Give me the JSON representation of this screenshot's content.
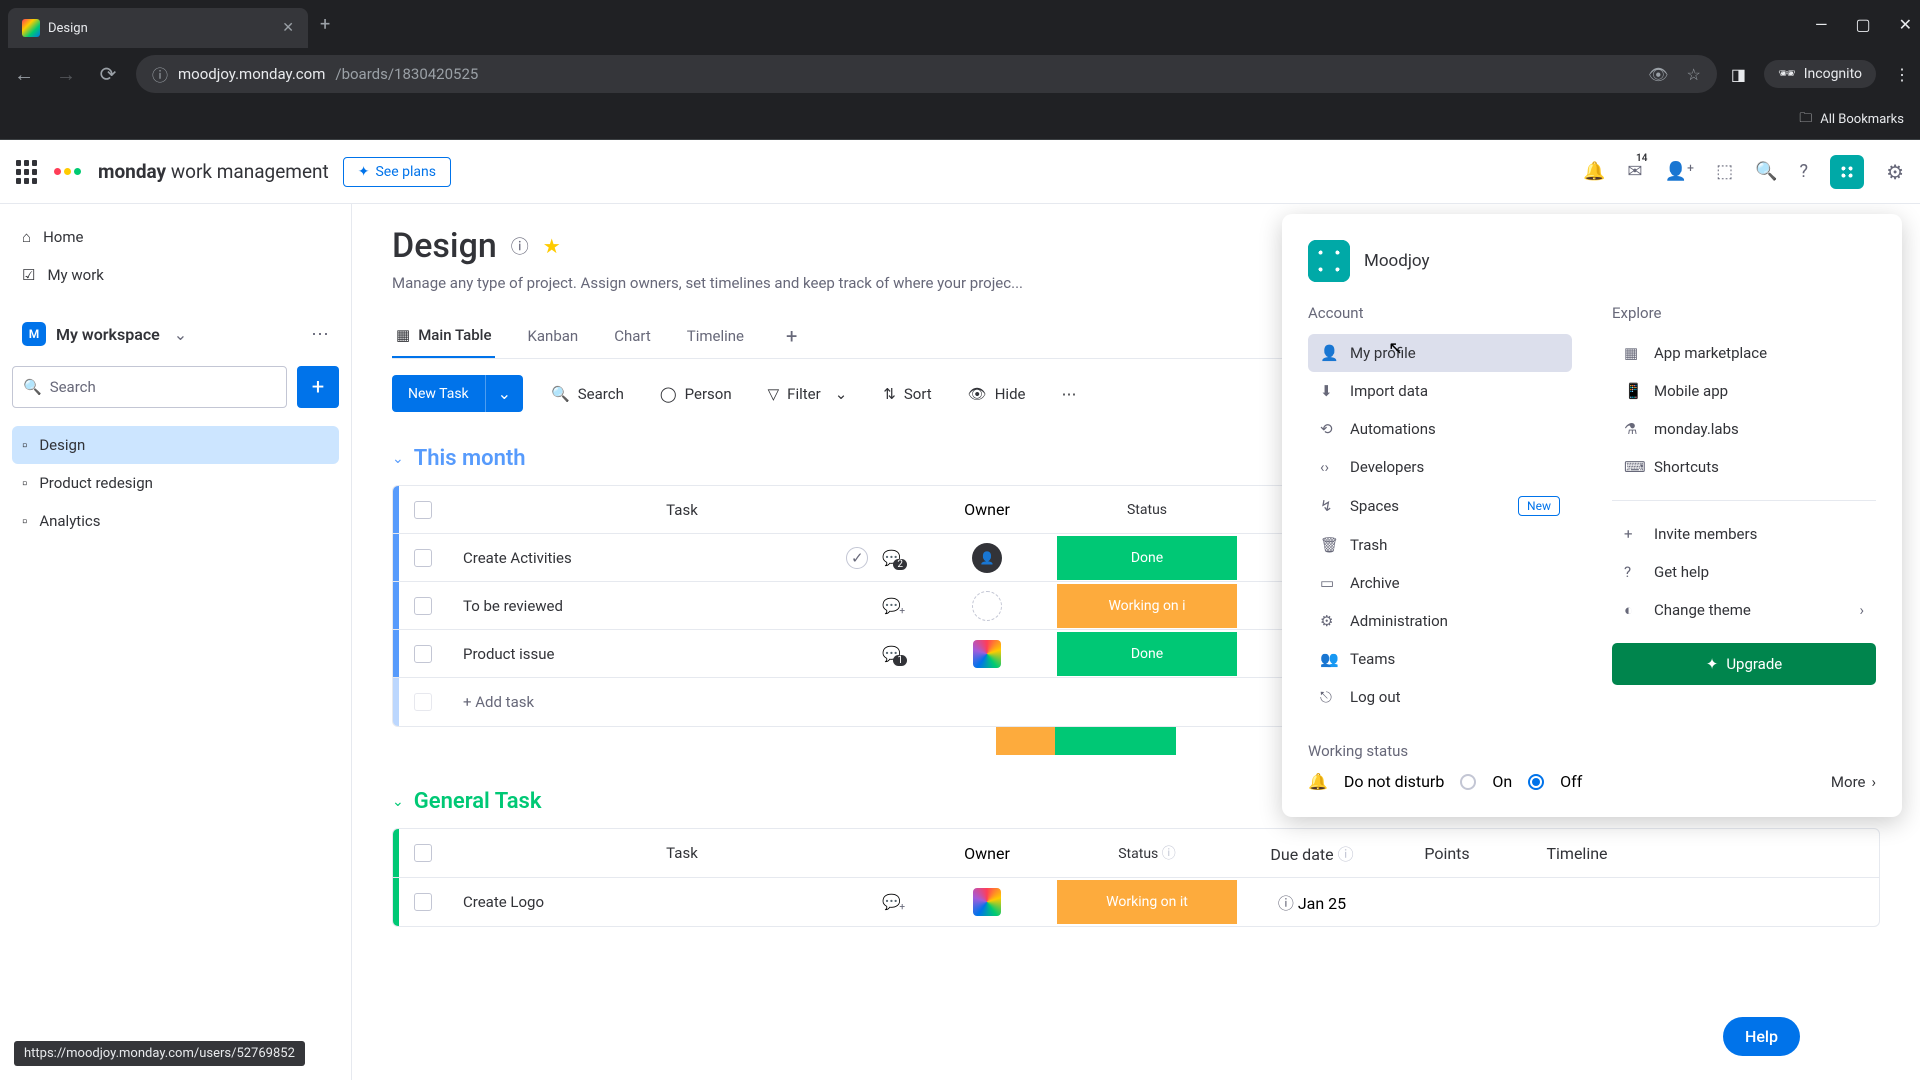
{
  "browser": {
    "tab_title": "Design",
    "url_host": "moodjoy.monday.com",
    "url_path": "/boards/1830420525",
    "incognito": "Incognito",
    "all_bookmarks": "All Bookmarks",
    "status_url": "https://moodjoy.monday.com/users/52769852"
  },
  "topbar": {
    "brand_bold": "monday",
    "brand_light": " work management",
    "see_plans": "See plans",
    "inbox_count": "14"
  },
  "sidebar": {
    "home": "Home",
    "my_work": "My work",
    "workspace": "My workspace",
    "workspace_initial": "M",
    "search_placeholder": "Search",
    "boards": [
      {
        "label": "Design",
        "active": true
      },
      {
        "label": "Product redesign",
        "active": false
      },
      {
        "label": "Analytics",
        "active": false
      }
    ]
  },
  "board": {
    "title": "Design",
    "description": "Manage any type of project. Assign owners, set timelines and keep track of where your projec...",
    "tabs": [
      {
        "label": "Main Table",
        "active": true
      },
      {
        "label": "Kanban",
        "active": false
      },
      {
        "label": "Chart",
        "active": false
      },
      {
        "label": "Timeline",
        "active": false
      }
    ],
    "new_task": "New Task",
    "toolbar": {
      "search": "Search",
      "person": "Person",
      "filter": "Filter",
      "sort": "Sort",
      "hide": "Hide"
    }
  },
  "headers": {
    "task": "Task",
    "owner": "Owner",
    "status": "Status",
    "due_date": "Due date",
    "points": "Points",
    "timeline": "Timeline"
  },
  "groups": [
    {
      "name": "This month",
      "color": "#579bfc",
      "rows": [
        {
          "task": "Create Activities",
          "owner_type": "avatar",
          "comments": "2",
          "checkmark": true,
          "status": "Done",
          "status_color": "#00c875"
        },
        {
          "task": "To be reviewed",
          "owner_type": "empty",
          "comments": "",
          "checkmark": false,
          "status": "Working on i",
          "status_color": "#fdab3d"
        },
        {
          "task": "Product issue",
          "owner_type": "logo",
          "comments": "1",
          "checkmark": false,
          "status": "Done",
          "status_color": "#00c875"
        }
      ],
      "add_task": "+ Add task",
      "summary": [
        {
          "color": "#fdab3d",
          "pct": 33
        },
        {
          "color": "#00c875",
          "pct": 67
        }
      ]
    },
    {
      "name": "General Task",
      "color": "#00c875",
      "rows": [
        {
          "task": "Create Logo",
          "owner_type": "logo",
          "comments": "",
          "checkmark": false,
          "status": "Working on it",
          "status_color": "#fdab3d",
          "due_date": "Jan 25"
        }
      ]
    }
  ],
  "menu": {
    "user": "Moodjoy",
    "account_section": "Account",
    "explore_section": "Explore",
    "account": [
      {
        "icon": "👤",
        "label": "My profile",
        "highlight": true
      },
      {
        "icon": "⬇",
        "label": "Import data"
      },
      {
        "icon": "⟲",
        "label": "Automations"
      },
      {
        "icon": "‹›",
        "label": "Developers"
      },
      {
        "icon": "↯",
        "label": "Spaces",
        "badge": "New"
      },
      {
        "icon": "🗑",
        "label": "Trash"
      },
      {
        "icon": "▭",
        "label": "Archive"
      },
      {
        "icon": "⚙",
        "label": "Administration"
      },
      {
        "icon": "👥",
        "label": "Teams"
      },
      {
        "icon": "⎋",
        "label": "Log out"
      }
    ],
    "explore": [
      {
        "icon": "▦",
        "label": "App marketplace"
      },
      {
        "icon": "📱",
        "label": "Mobile app"
      },
      {
        "icon": "⚗",
        "label": "monday.labs"
      },
      {
        "icon": "⌨",
        "label": "Shortcuts"
      }
    ],
    "secondary": [
      {
        "icon": "+",
        "label": "Invite members"
      },
      {
        "icon": "?",
        "label": "Get help"
      },
      {
        "icon": "◐",
        "label": "Change theme",
        "chevron": true
      }
    ],
    "upgrade": "Upgrade",
    "working_status": "Working status",
    "dnd": "Do not disturb",
    "on": "On",
    "off": "Off",
    "more": "More"
  },
  "help": "Help"
}
